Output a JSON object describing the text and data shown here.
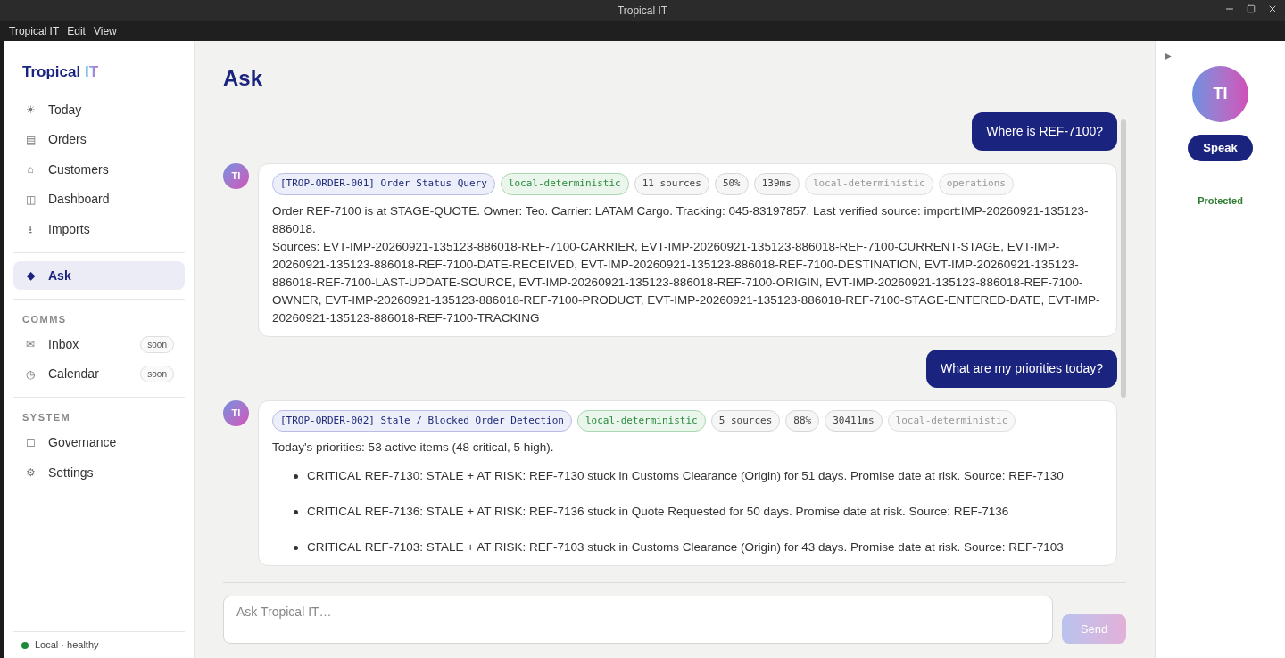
{
  "window": {
    "title": "Tropical IT"
  },
  "menu": [
    "Tropical IT",
    "Edit",
    "View"
  ],
  "brand": {
    "primary": "Tropical",
    "accent": "IT"
  },
  "sidebar": {
    "groups": [
      {
        "items": [
          {
            "icon": "☀",
            "label": "Today",
            "selected": false
          },
          {
            "icon": "▤",
            "label": "Orders",
            "selected": false
          },
          {
            "icon": "⌂",
            "label": "Customers",
            "selected": false
          },
          {
            "icon": "◫",
            "label": "Dashboard",
            "selected": false
          },
          {
            "icon": "⭳",
            "label": "Imports",
            "selected": false
          }
        ]
      },
      {
        "items": [
          {
            "icon": "◆",
            "label": "Ask",
            "selected": true
          }
        ]
      },
      {
        "heading": "COMMS",
        "items": [
          {
            "icon": "✉",
            "label": "Inbox",
            "selected": false,
            "badge": "soon"
          },
          {
            "icon": "◷",
            "label": "Calendar",
            "selected": false,
            "badge": "soon"
          }
        ]
      },
      {
        "heading": "SYSTEM",
        "items": [
          {
            "icon": "☐",
            "label": "Governance",
            "selected": false
          },
          {
            "icon": "⚙",
            "label": "Settings",
            "selected": false
          }
        ]
      }
    ],
    "status": {
      "label": "Local · healthy",
      "color": "#1a8a3a"
    }
  },
  "page_title": "Ask",
  "messages": [
    {
      "kind": "user",
      "text": "Where is REF-7100?"
    },
    {
      "kind": "assistant",
      "avatar": "TI",
      "chips": [
        {
          "kind": "title",
          "text": "[TROP-ORDER-001] Order Status Query"
        },
        {
          "kind": "engine",
          "text": "local-deterministic"
        },
        {
          "kind": "meta",
          "text": "11 sources"
        },
        {
          "kind": "meta",
          "text": "50%"
        },
        {
          "kind": "meta",
          "text": "139ms"
        },
        {
          "kind": "muted",
          "text": "local-deterministic"
        },
        {
          "kind": "muted",
          "text": "operations"
        }
      ],
      "paragraphs": [
        "Order REF-7100 is at STAGE-QUOTE. Owner: Teo. Carrier: LATAM Cargo. Tracking: 045-83197857. Last verified source: import:IMP-20260921-135123-886018.",
        "Sources: EVT-IMP-20260921-135123-886018-REF-7100-CARRIER, EVT-IMP-20260921-135123-886018-REF-7100-CURRENT-STAGE, EVT-IMP-20260921-135123-886018-REF-7100-DATE-RECEIVED, EVT-IMP-20260921-135123-886018-REF-7100-DESTINATION, EVT-IMP-20260921-135123-886018-REF-7100-LAST-UPDATE-SOURCE, EVT-IMP-20260921-135123-886018-REF-7100-ORIGIN, EVT-IMP-20260921-135123-886018-REF-7100-OWNER, EVT-IMP-20260921-135123-886018-REF-7100-PRODUCT, EVT-IMP-20260921-135123-886018-REF-7100-STAGE-ENTERED-DATE, EVT-IMP-20260921-135123-886018-REF-7100-TRACKING"
      ]
    },
    {
      "kind": "user",
      "text": "What are my priorities today?"
    },
    {
      "kind": "assistant",
      "avatar": "TI",
      "chips": [
        {
          "kind": "title",
          "text": "[TROP-ORDER-002] Stale / Blocked Order Detection"
        },
        {
          "kind": "engine",
          "text": "local-deterministic"
        },
        {
          "kind": "meta",
          "text": "5 sources"
        },
        {
          "kind": "meta",
          "text": "88%"
        },
        {
          "kind": "meta",
          "text": "30411ms"
        },
        {
          "kind": "muted",
          "text": "local-deterministic"
        }
      ],
      "paragraphs": [
        "Today's priorities: 53 active items (48 critical, 5 high)."
      ],
      "bullets": [
        "CRITICAL REF-7130: STALE + AT RISK: REF-7130 stuck in Customs Clearance (Origin) for 51 days. Promise date at risk. Source: REF-7130",
        "CRITICAL REF-7136: STALE + AT RISK: REF-7136 stuck in Quote Requested for 50 days. Promise date at risk. Source: REF-7136",
        "CRITICAL REF-7103: STALE + AT RISK: REF-7103 stuck in Customs Clearance (Origin) for 43 days. Promise date at risk. Source: REF-7103"
      ]
    }
  ],
  "composer": {
    "placeholder": "Ask Tropical IT…",
    "send": "Send",
    "disabled": true
  },
  "right_panel": {
    "collapse": "▶",
    "avatar": "TI",
    "speak": "Speak",
    "status": "Protected"
  }
}
